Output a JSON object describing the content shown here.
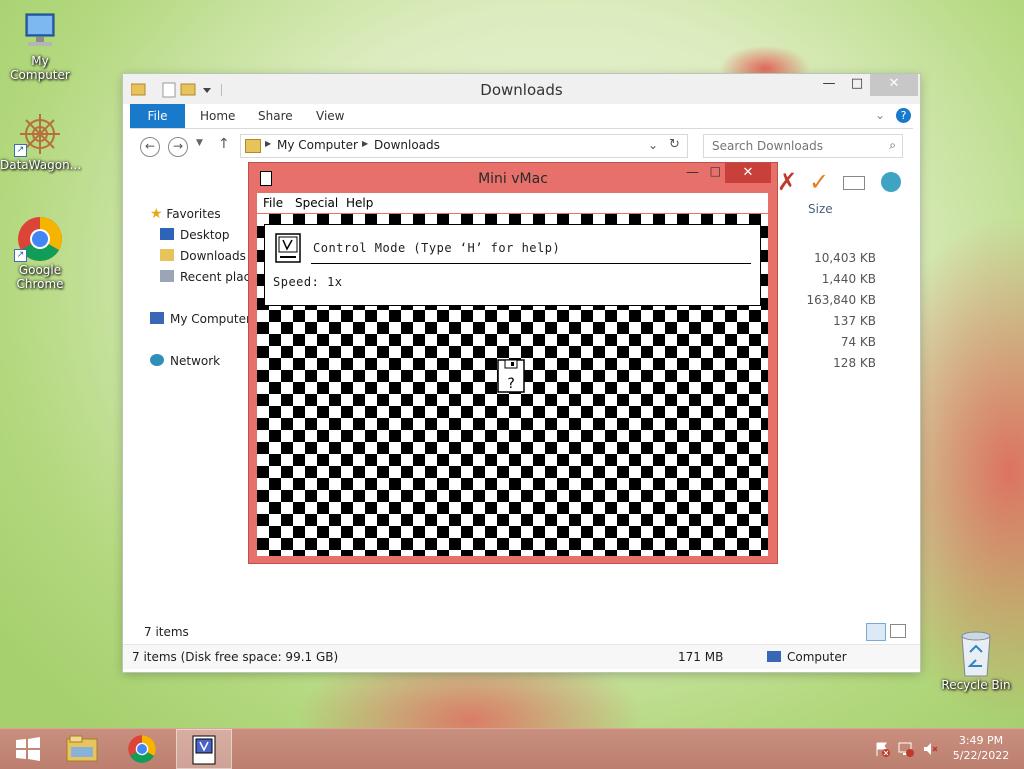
{
  "desktop": {
    "icons": [
      {
        "label": "My Computer"
      },
      {
        "label": "DataWagon..."
      },
      {
        "label": "Google Chrome"
      },
      {
        "label": "Recycle Bin"
      }
    ]
  },
  "explorer": {
    "title": "Downloads",
    "ribbon_tabs": [
      "File",
      "Home",
      "Share",
      "View"
    ],
    "breadcrumb": [
      "My Computer",
      "Downloads"
    ],
    "search_placeholder": "Search Downloads",
    "nav": {
      "favorites": "Favorites",
      "desktop": "Desktop",
      "downloads": "Downloads",
      "recent": "Recent places",
      "my_computer": "My Computer",
      "network": "Network"
    },
    "size_header": "Size",
    "sizes": [
      "10,403 KB",
      "1,440 KB",
      "163,840 KB",
      "137 KB",
      "74 KB",
      "128 KB"
    ],
    "items_count": "7 items",
    "status_left": "7 items (Disk free space: 99.1 GB)",
    "status_size": "171 MB",
    "status_location": "Computer"
  },
  "vmac": {
    "title": "Mini vMac",
    "menu": [
      "File",
      "Special",
      "Help"
    ],
    "control_mode_text": "Control Mode (Type ‘H’ for help)",
    "speed_text": "Speed: 1x"
  },
  "taskbar": {
    "time": "3:49 PM",
    "date": "5/22/2022"
  },
  "colors": {
    "ribbon_file": "#1979ca",
    "vmac_frame": "#e8706a",
    "taskbar": "#c08675"
  }
}
